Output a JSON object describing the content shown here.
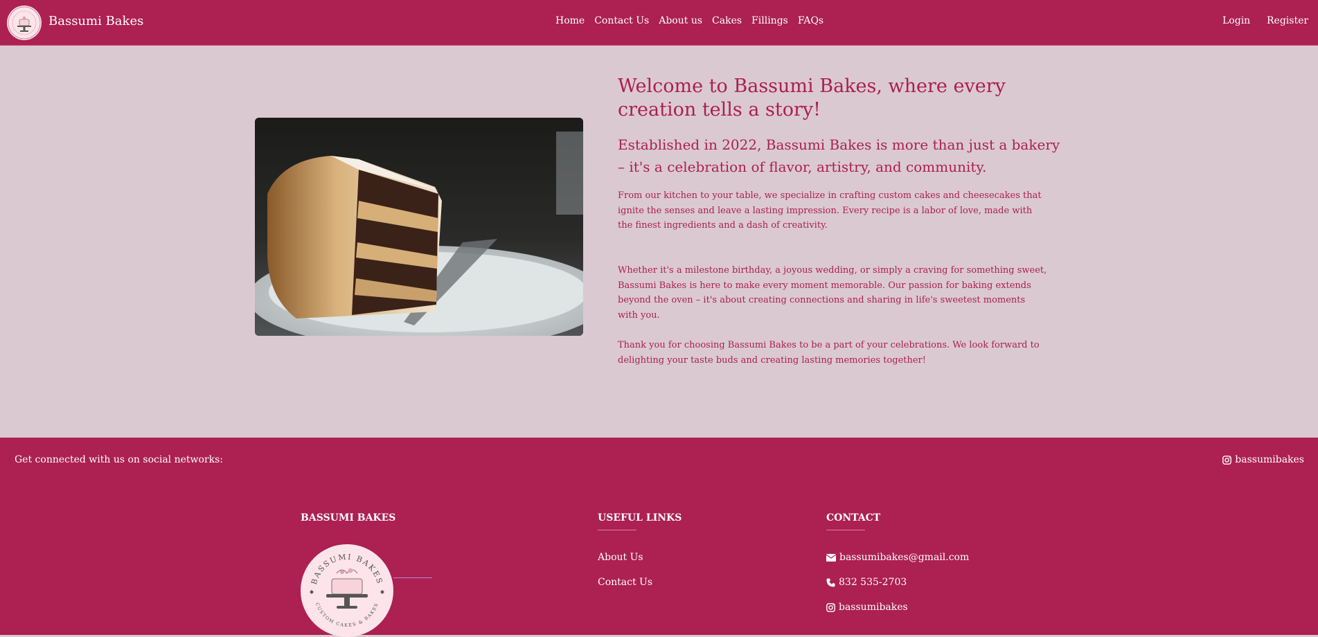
{
  "nav": {
    "brand": "Bassumi Bakes",
    "links": [
      "Home",
      "Contact Us",
      "About us",
      "Cakes",
      "Fillings",
      "FAQs"
    ],
    "login": "Login",
    "register": "Register"
  },
  "hero": {
    "title": "Welcome to Bassumi Bakes, where every creation tells a story!",
    "subtitle": "Established in 2022, Bassumi Bakes is more than just a bakery – it's a celebration of flavor, artistry, and community.",
    "paragraphs": [
      "From our kitchen to your table, we specialize in crafting custom cakes and cheesecakes that ignite the senses and leave a lasting impression. Every recipe is a labor of love, made with the finest ingredients and a dash of creativity.",
      "Whether it's a milestone birthday, a joyous wedding, or simply a craving for something sweet, Bassumi Bakes is here to make every moment memorable. Our passion for baking extends beyond the oven – it's about creating connections and sharing in life's sweetest moments with you.",
      "Thank you for choosing Bassumi Bakes to be a part of your celebrations. We look forward to delighting your taste buds and creating lasting memories together!"
    ]
  },
  "footer": {
    "social_text": "Get connected with us on social networks:",
    "social_handle": "bassumibakes",
    "col1_title": "BASSUMI BAKES",
    "logo_text_top": "BASSUMI BAKES",
    "logo_text_bottom": "CUSTOM CAKES & BAKES",
    "col2_title": "USEFUL LINKS",
    "links": [
      "About Us",
      "Contact Us"
    ],
    "col3_title": "CONTACT",
    "email": "bassumibakes@gmail.com",
    "phone": "832 535-2703",
    "instagram": "bassumibakes"
  },
  "colors": {
    "brand": "#ac2052",
    "background": "#dbc9d1",
    "text_accent": "#a9204f"
  },
  "icons": [
    "instagram-icon",
    "envelope-icon",
    "phone-icon"
  ]
}
